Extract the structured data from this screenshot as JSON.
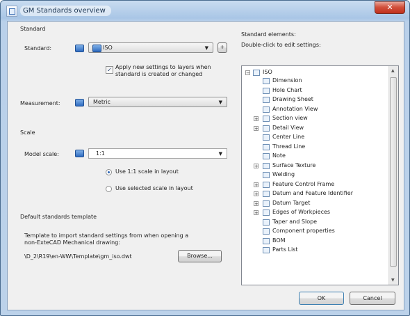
{
  "window": {
    "title": "GM Standards overview",
    "close_glyph": "✕"
  },
  "standard_section": {
    "group_label": "Standard",
    "standard_label": "Standard:",
    "standard_value": "ISO",
    "more_button": "+",
    "apply_checkbox_line1": "Apply new settings to layers when",
    "apply_checkbox_line2": "standard is created or changed",
    "apply_checked": true,
    "measurement_label": "Measurement:",
    "measurement_value": "Metric"
  },
  "scale_section": {
    "group_label": "Scale",
    "model_scale_label": "Model scale:",
    "model_scale_value": "1:1",
    "radio_use_11": "Use 1:1 scale in layout",
    "radio_use_selected": "Use selected scale in layout",
    "selected": "use_11"
  },
  "template_section": {
    "group_label": "Default standards template",
    "description_line1": "Template to import standard settings from when opening a",
    "description_line2": "non-ExteCAD Mechanical drawing:",
    "path": "\\D_2\\R19\\en-WW\\Template\\gm_iso.dwt",
    "browse_button": "Browse..."
  },
  "elements_section": {
    "title": "Standard elements:",
    "hint": "Double-click to edit settings:",
    "root": "ISO",
    "items": [
      {
        "label": "Dimension",
        "icon": "dimension-icon",
        "expandable": false
      },
      {
        "label": "Hole Chart",
        "icon": "hole-chart-icon",
        "expandable": false
      },
      {
        "label": "Drawing Sheet",
        "icon": "drawing-sheet-icon",
        "expandable": false
      },
      {
        "label": "Annotation View",
        "icon": "annotation-view-icon",
        "expandable": false
      },
      {
        "label": "Section view",
        "icon": "section-view-icon",
        "expandable": true
      },
      {
        "label": "Detail View",
        "icon": "detail-view-icon",
        "expandable": true
      },
      {
        "label": "Center Line",
        "icon": "center-line-icon",
        "expandable": false
      },
      {
        "label": "Thread Line",
        "icon": "thread-line-icon",
        "expandable": false
      },
      {
        "label": "Note",
        "icon": "note-icon",
        "expandable": false
      },
      {
        "label": "Surface Texture",
        "icon": "surface-texture-icon",
        "expandable": true
      },
      {
        "label": "Welding",
        "icon": "welding-icon",
        "expandable": false
      },
      {
        "label": "Feature Control Frame",
        "icon": "feature-control-frame-icon",
        "expandable": true
      },
      {
        "label": "Datum and Feature Identifier",
        "icon": "datum-feature-identifier-icon",
        "expandable": true
      },
      {
        "label": "Datum Target",
        "icon": "datum-target-icon",
        "expandable": true
      },
      {
        "label": "Edges of Workpieces",
        "icon": "edges-of-workpieces-icon",
        "expandable": true
      },
      {
        "label": "Taper and Slope",
        "icon": "taper-and-slope-icon",
        "expandable": false
      },
      {
        "label": "Component properties",
        "icon": "component-properties-icon",
        "expandable": false
      },
      {
        "label": "BOM",
        "icon": "bom-icon",
        "expandable": false
      },
      {
        "label": "Parts List",
        "icon": "parts-list-icon",
        "expandable": false
      }
    ]
  },
  "footer": {
    "ok_button": "OK",
    "cancel_button": "Cancel"
  }
}
